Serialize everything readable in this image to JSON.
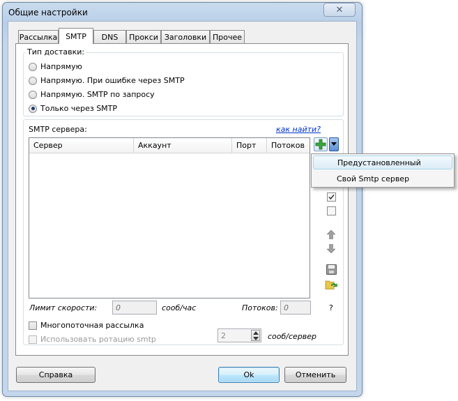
{
  "window": {
    "title": "Общие настройки",
    "close_glyph": "✕"
  },
  "tabs": [
    {
      "label": "Рассылка",
      "active": false
    },
    {
      "label": "SMTP",
      "active": true
    },
    {
      "label": "DNS",
      "active": false
    },
    {
      "label": "Прокси",
      "active": false
    },
    {
      "label": "Заголовки",
      "active": false
    },
    {
      "label": "Прочее",
      "active": false
    }
  ],
  "delivery": {
    "label": "Тип доставки:",
    "options": [
      {
        "label": "Напрямую",
        "selected": false
      },
      {
        "label": "Напрямую. При ошибке через SMTP",
        "selected": false
      },
      {
        "label": "Напрямую. SMTP по запросу",
        "selected": false
      },
      {
        "label": "Только через SMTP",
        "selected": true
      }
    ]
  },
  "smtp": {
    "label": "SMTP сервера:",
    "find_link": "как найти?",
    "columns": [
      "Сервер",
      "Аккаунт",
      "Порт",
      "Потоков"
    ],
    "rows": [],
    "speed_limit_label": "Лимит скорости:",
    "speed_limit_value": "0",
    "speed_unit": "сооб/час",
    "threads_label": "Потоков:",
    "threads_value": "0",
    "help_glyph": "?",
    "multithread_label": "Многопоточная рассылка",
    "multithread_checked": false,
    "rotation_label": "Использовать ротацию smtp",
    "rotation_checked": false,
    "rotation_value": "2",
    "rotation_unit": "сооб/сервер"
  },
  "icons": [
    "plus-icon",
    "dropdown-arrow-icon",
    "check-all-icon",
    "uncheck-all-icon",
    "arrow-up-icon",
    "arrow-down-icon",
    "save-icon",
    "open-folder-icon"
  ],
  "menu": {
    "items": [
      {
        "label": "Предустановленный",
        "highlighted": true
      },
      {
        "label": "Свой Smtp сервер",
        "highlighted": false
      }
    ]
  },
  "buttons": {
    "help": "Справка",
    "ok": "Ok",
    "cancel": "Отменить"
  },
  "colors": {
    "accent_green": "#3aa63a",
    "link": "#0033cc",
    "window_frame": "#c3d6ec"
  }
}
